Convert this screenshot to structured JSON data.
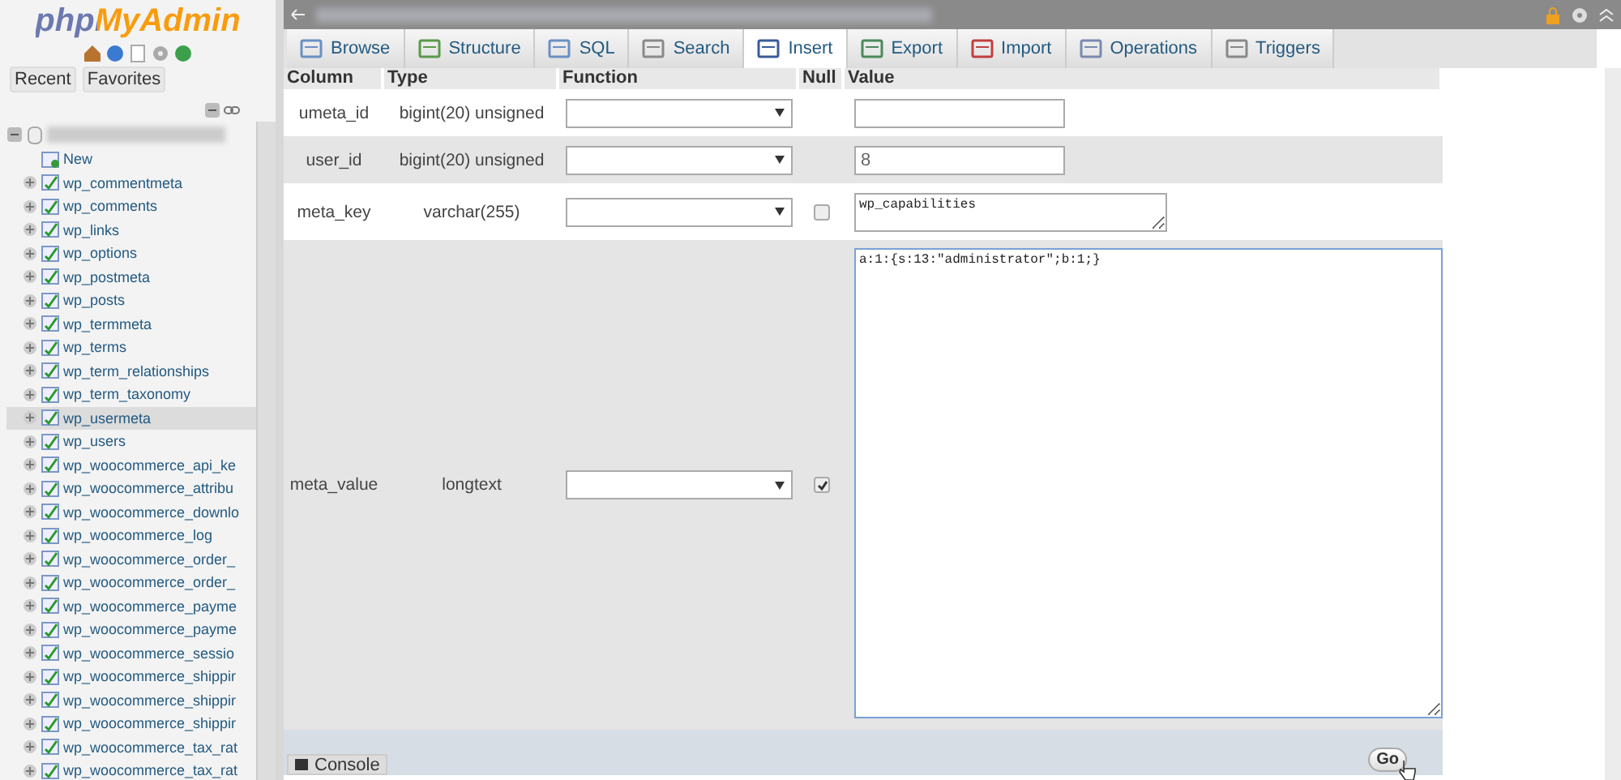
{
  "sidebar": {
    "logo": "phpMyAdmin",
    "buttons": [
      "Recent",
      "Favorites"
    ],
    "tree": {
      "expanded": true,
      "children": [
        {
          "name": "New",
          "kind": "new"
        },
        {
          "name": "wp_commentmeta",
          "kind": "table",
          "selected": false
        },
        {
          "name": "wp_comments",
          "kind": "table",
          "selected": false
        },
        {
          "name": "wp_links",
          "kind": "table",
          "selected": false
        },
        {
          "name": "wp_options",
          "kind": "table",
          "selected": false
        },
        {
          "name": "wp_postmeta",
          "kind": "table",
          "selected": false
        },
        {
          "name": "wp_posts",
          "kind": "table",
          "selected": false
        },
        {
          "name": "wp_termmeta",
          "kind": "table",
          "selected": false
        },
        {
          "name": "wp_terms",
          "kind": "table",
          "selected": false
        },
        {
          "name": "wp_term_relationships",
          "kind": "table",
          "selected": false
        },
        {
          "name": "wp_term_taxonomy",
          "kind": "table",
          "selected": false
        },
        {
          "name": "wp_usermeta",
          "kind": "table",
          "selected": true
        },
        {
          "name": "wp_users",
          "kind": "table",
          "selected": false
        },
        {
          "name": "wp_woocommerce_api_ke",
          "kind": "table",
          "selected": false
        },
        {
          "name": "wp_woocommerce_attribu",
          "kind": "table",
          "selected": false
        },
        {
          "name": "wp_woocommerce_downlo",
          "kind": "table",
          "selected": false
        },
        {
          "name": "wp_woocommerce_log",
          "kind": "table",
          "selected": false
        },
        {
          "name": "wp_woocommerce_order_",
          "kind": "table",
          "selected": false
        },
        {
          "name": "wp_woocommerce_order_",
          "kind": "table",
          "selected": false
        },
        {
          "name": "wp_woocommerce_payme",
          "kind": "table",
          "selected": false
        },
        {
          "name": "wp_woocommerce_payme",
          "kind": "table",
          "selected": false
        },
        {
          "name": "wp_woocommerce_sessio",
          "kind": "table",
          "selected": false
        },
        {
          "name": "wp_woocommerce_shippir",
          "kind": "table",
          "selected": false
        },
        {
          "name": "wp_woocommerce_shippir",
          "kind": "table",
          "selected": false
        },
        {
          "name": "wp_woocommerce_shippir",
          "kind": "table",
          "selected": false
        },
        {
          "name": "wp_woocommerce_tax_rat",
          "kind": "table",
          "selected": false
        },
        {
          "name": "wp_woocommerce_tax_rat",
          "kind": "table",
          "selected": false
        }
      ]
    }
  },
  "tabs": [
    {
      "label": "Browse",
      "selected": false
    },
    {
      "label": "Structure",
      "selected": false
    },
    {
      "label": "SQL",
      "selected": false
    },
    {
      "label": "Search",
      "selected": false
    },
    {
      "label": "Insert",
      "selected": true
    },
    {
      "label": "Export",
      "selected": false
    },
    {
      "label": "Import",
      "selected": false
    },
    {
      "label": "Operations",
      "selected": false
    },
    {
      "label": "Triggers",
      "selected": false
    }
  ],
  "table": {
    "columns": [
      "Column",
      "Type",
      "Function",
      "Null",
      "Value"
    ],
    "rows": [
      {
        "column": "umeta_id",
        "type": "bigint(20) unsigned",
        "kind": "input",
        "value": ""
      },
      {
        "column": "user_id",
        "type": "bigint(20) unsigned",
        "kind": "input",
        "value": "8"
      },
      {
        "column": "meta_key",
        "type": "varchar(255)",
        "kind": "textarea",
        "null_checked": false,
        "value": "wp_capabilities"
      },
      {
        "column": "meta_value",
        "type": "longtext",
        "kind": "bigtextarea",
        "null_checked": true,
        "value": "a:1:{s:13:\"administrator\";b:1;}"
      }
    ]
  },
  "go_button": "Go",
  "console": "Console"
}
